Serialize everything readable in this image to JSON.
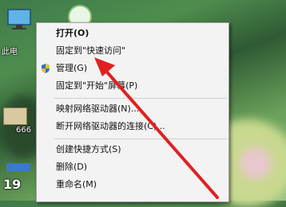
{
  "desktop": {
    "icons": [
      {
        "label": "此电",
        "icon": "this-pc-icon"
      },
      {
        "label": "666",
        "icon": "folder-icon"
      },
      {
        "label": "19",
        "icon": "app-icon"
      }
    ]
  },
  "context_menu": {
    "items": [
      {
        "label": "打开(O)",
        "bold": true
      },
      {
        "label": "固定到\"快速访问\""
      },
      {
        "label": "管理(G)",
        "icon": "shield-icon"
      },
      {
        "label": "固定到\"开始\"屏幕(P)"
      },
      {
        "label": "映射网络驱动器(N)..."
      },
      {
        "label": "断开网络驱动器的连接(C)..."
      },
      {
        "label": "创建快捷方式(S)"
      },
      {
        "label": "删除(D)"
      },
      {
        "label": "重命名(M)"
      }
    ]
  },
  "annotation": {
    "icon": "red-arrow-icon",
    "color": "#e02020"
  }
}
